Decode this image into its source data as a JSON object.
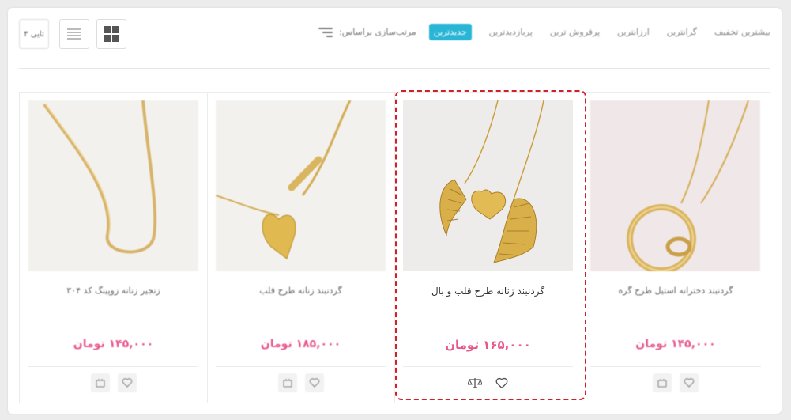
{
  "sort": {
    "label": "مرتب‌سازی براساس:",
    "options": [
      {
        "label": "جدیدترین",
        "active": true
      },
      {
        "label": "پربازدیدترین",
        "active": false
      },
      {
        "label": "پرفروش ترین",
        "active": false
      },
      {
        "label": "ارزانترین",
        "active": false
      },
      {
        "label": "گرانترین",
        "active": false
      },
      {
        "label": "بیشترین تخفیف",
        "active": false
      }
    ]
  },
  "view": {
    "count_label": "۴ تایی"
  },
  "products": [
    {
      "title": "زنجیر زنانه زوپینگ کد ۳۰۴",
      "price": "۱۴۵,۰۰۰ تومان"
    },
    {
      "title": "گردنبند زنانه طرح قلب",
      "price": "۱۸۵,۰۰۰ تومان"
    },
    {
      "title": "گردنبند زنانه طرح قلب و بال",
      "price": "۱۶۵,۰۰۰ تومان"
    },
    {
      "title": "گردنبند دخترانه استیل طرح گره",
      "price": "۱۴۵,۰۰۰ تومان"
    }
  ],
  "colors": {
    "accent": "#29b6d6",
    "price": "#e8578c",
    "highlight": "#d0212a"
  },
  "icons": {
    "sort": "sort-lines-icon",
    "grid": "grid-view-icon",
    "list": "list-view-icon",
    "wishlist": "heart-icon",
    "compare": "scale-icon"
  }
}
